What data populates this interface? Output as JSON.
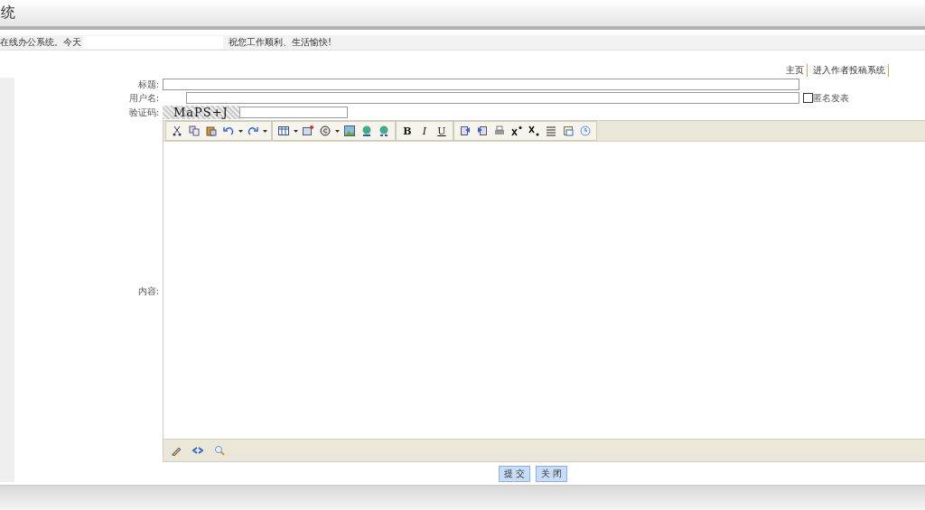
{
  "header": {
    "title": "统"
  },
  "notice": {
    "left": "在线办公系统。今天",
    "right": "祝您工作顺利、生活愉快!"
  },
  "top_links": [
    "主页",
    "进入作者投稿系统"
  ],
  "form": {
    "title_label": "标题:",
    "username_label": "用户名:",
    "anonymous": {
      "label": "匿名发表",
      "checked": false
    },
    "captcha_label": "验证码:",
    "captcha": "MaPS+J",
    "content_label": "内容:"
  },
  "format_buttons": [
    "B",
    "I",
    "U"
  ],
  "buttons": [
    "提 交",
    "关 闭"
  ]
}
